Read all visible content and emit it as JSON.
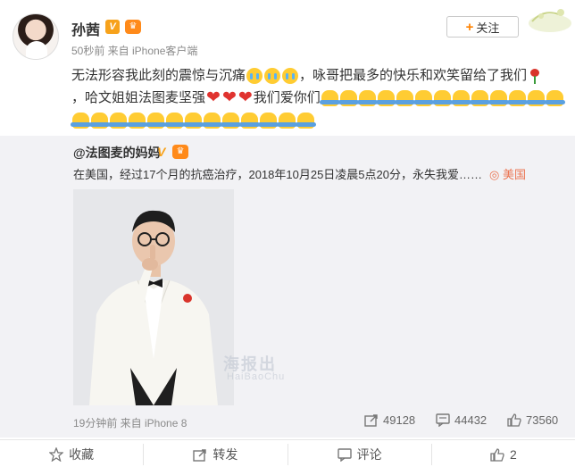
{
  "post": {
    "author": "孙茜",
    "v_badge": "V",
    "meta": "50秒前 来自 iPhone客户端",
    "follow_label": "关注",
    "text_line1": "无法形容我此刻的震惊与沉痛",
    "text_line1b": "，咏哥把最多的快乐和欢笑留给了我们",
    "text_line2a": "，哈文姐姐法图麦坚强",
    "text_line2b": "我们爱你们"
  },
  "repost": {
    "author": "@法图麦的妈妈",
    "v_badge": "V",
    "text": "在美国，经过17个月的抗癌治疗，2018年10月25日凌晨5点20分，永失我爱……",
    "location": "美国",
    "watermark": "海报出",
    "watermark_sub": "HaiBaoChu",
    "time": "19分钟前 来自 iPhone 8",
    "reposts": "49128",
    "comments": "44432",
    "likes": "73560"
  },
  "actions": {
    "collect": "收藏",
    "forward": "转发",
    "comment": "评论",
    "like": "2"
  },
  "colors": {
    "accent": "#ff8200",
    "location": "#eb7350",
    "repost_bg": "#f2f2f5"
  }
}
